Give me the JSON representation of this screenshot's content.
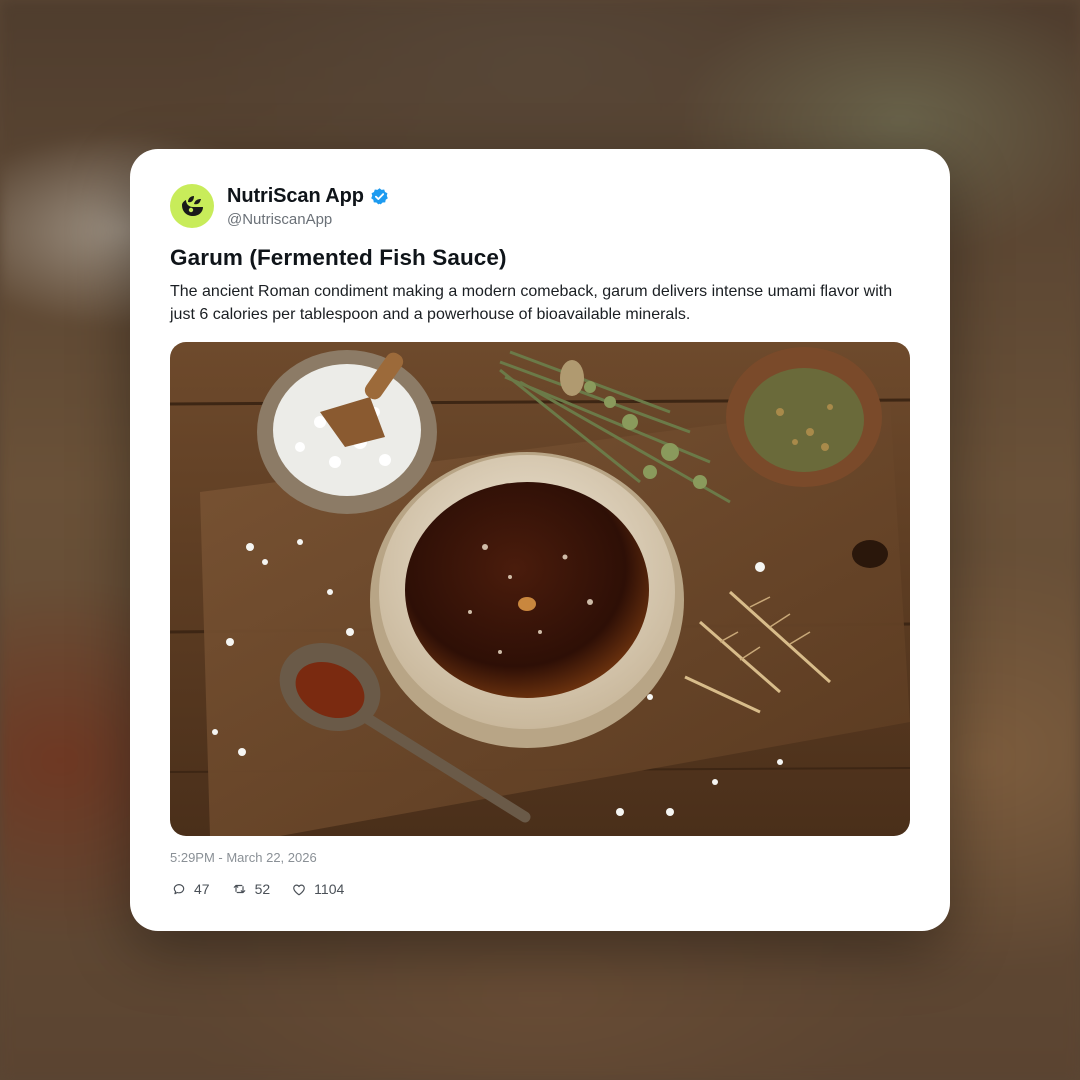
{
  "post": {
    "author": {
      "display_name": "NutriScan App",
      "handle": "@NutriscanApp",
      "verified": true,
      "avatar_color": "#c8ec5a",
      "verified_color": "#1d9bf0"
    },
    "title": "Garum (Fermented Fish Sauce)",
    "body": "The ancient Roman condiment making a modern comeback, garum delivers intense umami flavor with just 6 calories per tablespoon and a powerhouse of bioavailable minerals.",
    "timestamp": "5:29PM - March 22, 2026",
    "stats": {
      "replies": "47",
      "reposts": "52",
      "likes": "1104"
    },
    "image_icon": "garum-bowl-photo"
  }
}
